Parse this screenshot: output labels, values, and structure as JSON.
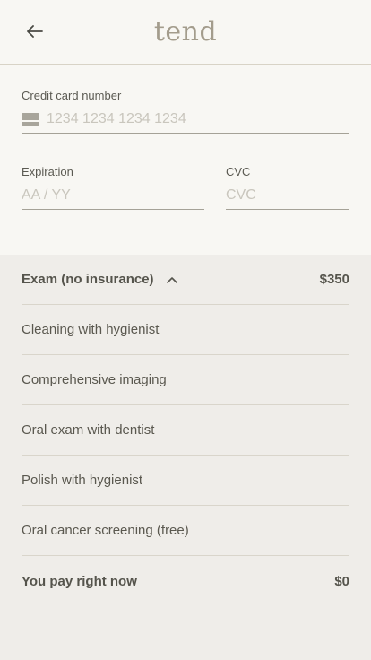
{
  "header": {
    "logo": "tend"
  },
  "form": {
    "card_number": {
      "label": "Credit card number",
      "placeholder": "1234 1234 1234 1234"
    },
    "expiration": {
      "label": "Expiration",
      "placeholder": "AA / YY"
    },
    "cvc": {
      "label": "CVC",
      "placeholder": "CVC"
    }
  },
  "summary": {
    "exam": {
      "label": "Exam (no insurance)",
      "price": "$350"
    },
    "items": [
      "Cleaning with hygienist",
      "Comprehensive imaging",
      "Oral exam with dentist",
      "Polish with hygienist",
      "Oral cancer screening (free)"
    ],
    "total": {
      "label": "You pay right now",
      "price": "$0"
    }
  }
}
